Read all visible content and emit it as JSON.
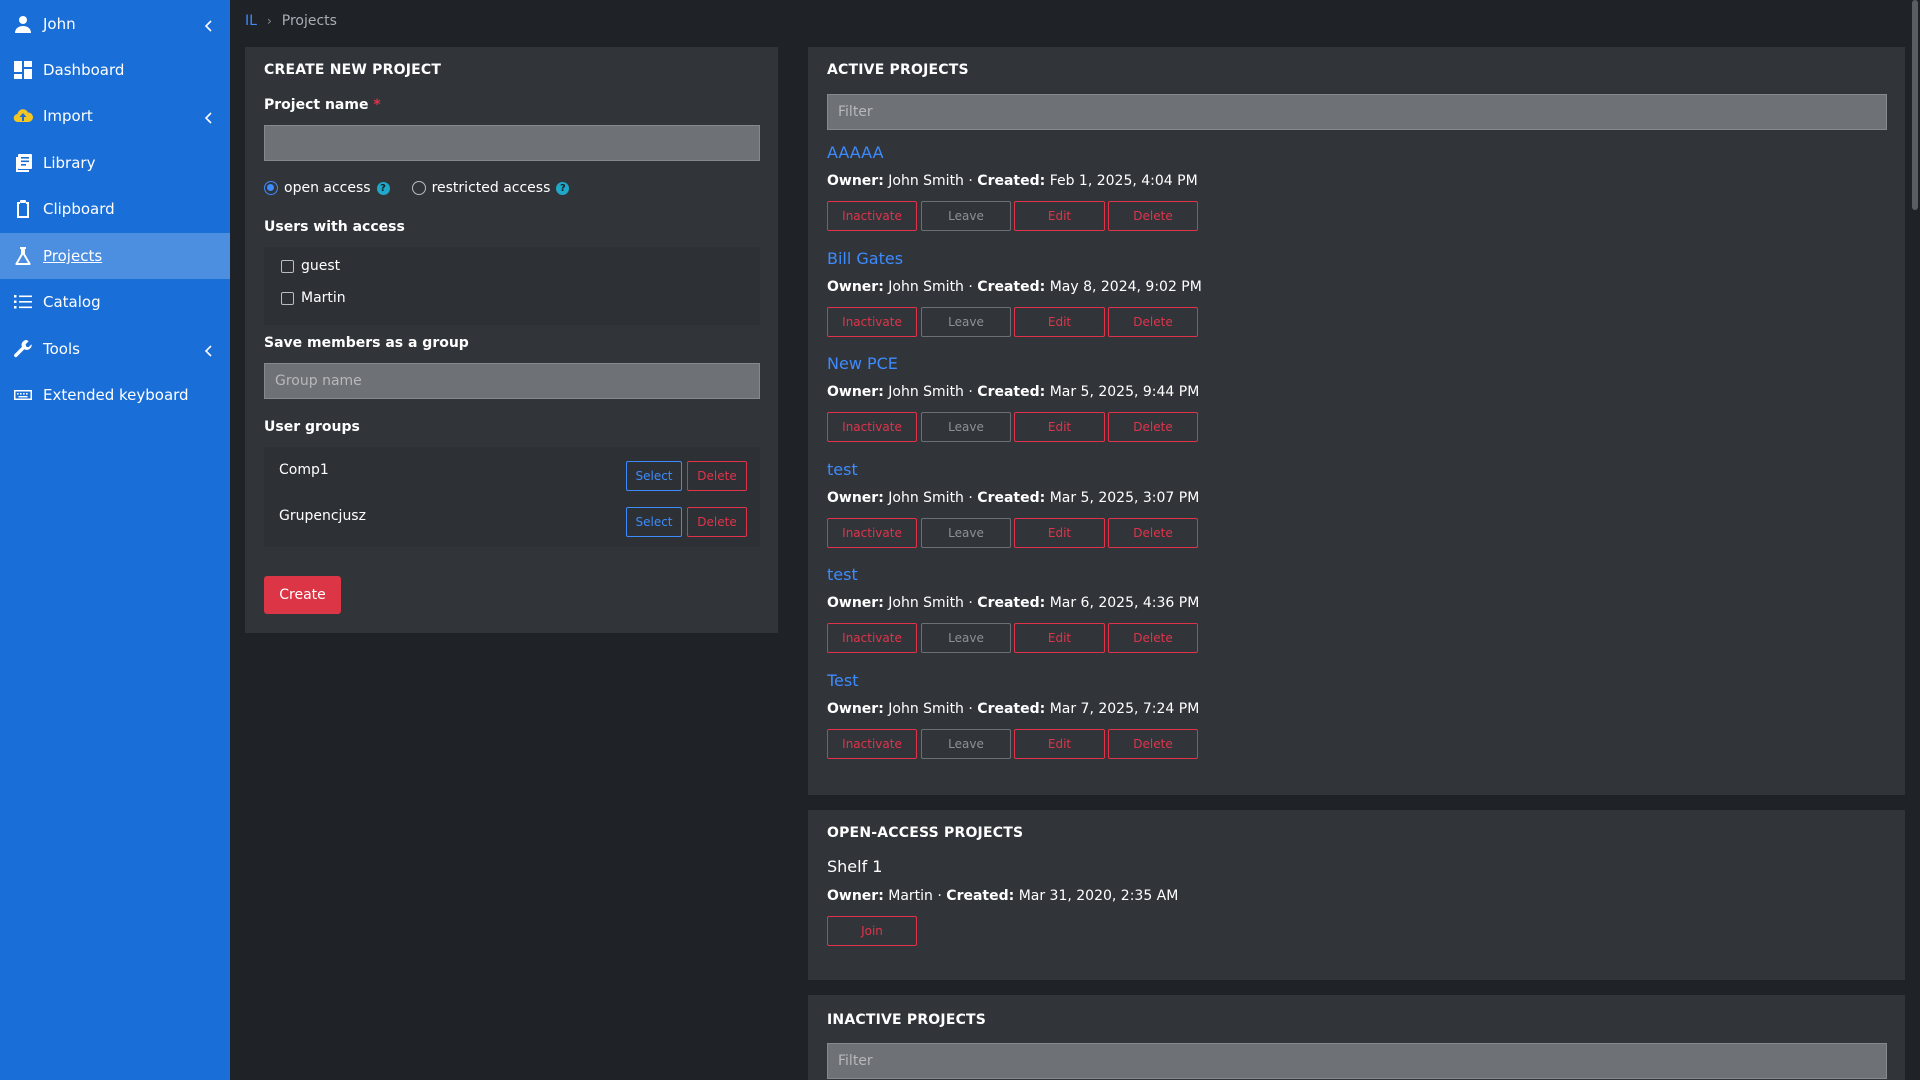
{
  "sidebar": {
    "items": [
      {
        "label": "John",
        "icon": "user-icon",
        "chevron": true
      },
      {
        "label": "Dashboard",
        "icon": "dashboard-icon",
        "chevron": false
      },
      {
        "label": "Import",
        "icon": "cloud-upload-icon",
        "chevron": true
      },
      {
        "label": "Library",
        "icon": "library-icon",
        "chevron": false
      },
      {
        "label": "Clipboard",
        "icon": "clipboard-icon",
        "chevron": false
      },
      {
        "label": "Projects",
        "icon": "flask-icon",
        "chevron": false,
        "active": true
      },
      {
        "label": "Catalog",
        "icon": "list-icon",
        "chevron": false
      },
      {
        "label": "Tools",
        "icon": "wrench-icon",
        "chevron": true
      },
      {
        "label": "Extended keyboard",
        "icon": "keyboard-icon",
        "chevron": false
      }
    ]
  },
  "breadcrumb": {
    "root": "IL",
    "current": "Projects"
  },
  "create": {
    "title": "CREATE NEW PROJECT",
    "project_name_label": "Project name",
    "required_mark": "*",
    "project_name_value": "",
    "access": {
      "open": "open access",
      "restricted": "restricted access",
      "selected": "open"
    },
    "users_label": "Users with access",
    "users": [
      "guest",
      "Martin"
    ],
    "save_group_label": "Save members as a group",
    "group_name_placeholder": "Group name",
    "user_groups_label": "User groups",
    "groups": [
      "Comp1",
      "Grupencjusz"
    ],
    "select_label": "Select",
    "delete_label": "Delete",
    "create_label": "Create"
  },
  "active": {
    "title": "ACTIVE PROJECTS",
    "filter_placeholder": "Filter",
    "owner_label": "Owner:",
    "created_label": "Created:",
    "buttons": {
      "inactivate": "Inactivate",
      "leave": "Leave",
      "edit": "Edit",
      "delete": "Delete"
    },
    "projects": [
      {
        "name": "AAAAA",
        "owner": "John Smith",
        "created": "Feb 1, 2025, 4:04 PM"
      },
      {
        "name": "Bill Gates",
        "owner": "John Smith",
        "created": "May 8, 2024, 9:02 PM"
      },
      {
        "name": "New PCE",
        "owner": "John Smith",
        "created": "Mar 5, 2025, 9:44 PM"
      },
      {
        "name": "test",
        "owner": "John Smith",
        "created": "Mar 5, 2025, 3:07 PM"
      },
      {
        "name": "test",
        "owner": "John Smith",
        "created": "Mar 6, 2025, 4:36 PM"
      },
      {
        "name": "Test",
        "owner": "John Smith",
        "created": "Mar 7, 2025, 7:24 PM"
      }
    ]
  },
  "open_access": {
    "title": "OPEN-ACCESS PROJECTS",
    "projects": [
      {
        "name": "Shelf 1",
        "owner": "Martin",
        "created": "Mar 31, 2020, 2:35 AM"
      }
    ],
    "join_label": "Join"
  },
  "inactive": {
    "title": "INACTIVE PROJECTS",
    "filter_placeholder": "Filter"
  },
  "colors": {
    "sidebar": "#1a6ed8",
    "sidebar_active": "#4c8ee0",
    "panel": "#31353a",
    "background": "#1f2226",
    "link": "#3d8bfd",
    "danger": "#e0334a"
  }
}
